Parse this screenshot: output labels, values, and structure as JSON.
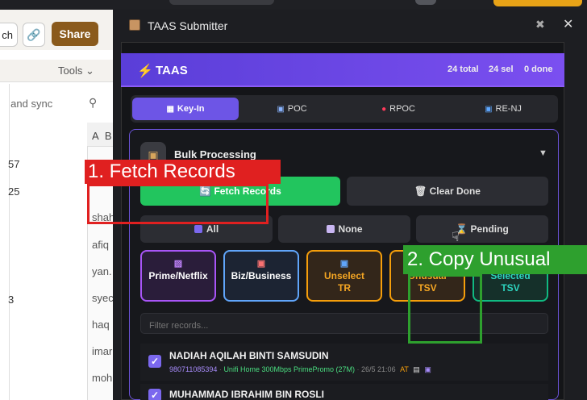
{
  "sheet": {
    "btn_partial": "ch",
    "share_label": "Share",
    "tools_label": "Tools",
    "sync_text": "re and sync",
    "col_headers": [
      "A",
      "B"
    ],
    "left_values": [
      "57",
      "25",
      "",
      "",
      "",
      "3",
      "",
      "",
      "",
      ""
    ],
    "right_values": [
      "",
      "",
      "shah",
      "afiq",
      "yan.",
      "syec",
      "haq",
      "imar",
      "moh",
      ""
    ]
  },
  "window": {
    "title": "TAAS Submitter",
    "header_title": "TAAS",
    "total": "24 total",
    "sel": "24 sel",
    "done": "0 done",
    "tabs": [
      {
        "label": "Key-In",
        "icon": "keyboard-icon"
      },
      {
        "label": "POC",
        "icon": "screen-icon"
      },
      {
        "label": "RPOC",
        "icon": "red-dot-icon"
      },
      {
        "label": "RE-NJ",
        "icon": "blue-square-icon"
      }
    ],
    "section_title": "Bulk Processing",
    "fetch_label": "Fetch Records",
    "clear_label": "Clear Done",
    "all_label": "All",
    "none_label": "None",
    "pending_label": "Pending",
    "filter_buttons": [
      {
        "line1": "Prime/Netflix",
        "line2": ""
      },
      {
        "line1": "Biz/Business",
        "line2": ""
      },
      {
        "line1": "Unselect",
        "line2": "TR"
      },
      {
        "line1": "Unusual",
        "line2": "TSV"
      },
      {
        "line1": "Selected",
        "line2": "TSV"
      }
    ],
    "filter_placeholder": "Filter records...",
    "records": [
      {
        "name": "NADIAH AQILAH BINTI SAMSUDIN",
        "id": "980711085394",
        "plan": "Unifi Home 300Mbps PrimePromo (27M)",
        "date": "26/5 21:06",
        "tag": "AT"
      },
      {
        "name": "MUHAMMAD IBRAHIM BIN ROSLI",
        "id": "",
        "plan": "",
        "date": "",
        "tag": ""
      }
    ]
  },
  "annotations": {
    "step1": "1. Fetch Records",
    "step2": "2. Copy Unusual"
  },
  "colors": {
    "accent": "#7b4ff0",
    "fetch_green": "#22c55e",
    "annot_red": "#e02020",
    "annot_green": "#2ea02e"
  }
}
